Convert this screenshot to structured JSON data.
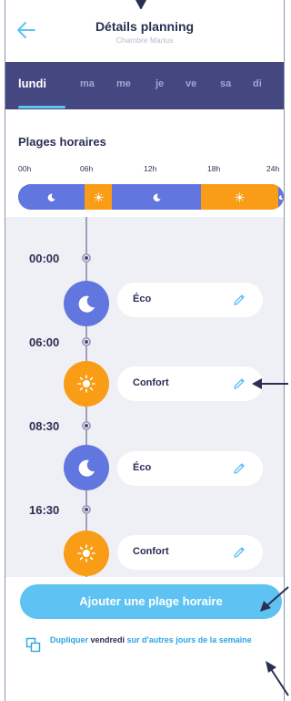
{
  "header": {
    "title": "Détails planning",
    "subtitle": "Chambre Marius"
  },
  "days": [
    {
      "label": "lundi",
      "active": true
    },
    {
      "label": "ma",
      "active": false
    },
    {
      "label": "me",
      "active": false
    },
    {
      "label": "je",
      "active": false
    },
    {
      "label": "ve",
      "active": false
    },
    {
      "label": "sa",
      "active": false
    },
    {
      "label": "di",
      "active": false
    }
  ],
  "ranges": {
    "title": "Plages horaires",
    "ticks": [
      "00h",
      "06h",
      "12h",
      "18h",
      "24h"
    ],
    "segments": [
      {
        "mode": "eco",
        "icon": "moon-icon",
        "start": "00:00",
        "end": "06:00"
      },
      {
        "mode": "confort",
        "icon": "sun-icon",
        "start": "06:00",
        "end": "08:30"
      },
      {
        "mode": "eco",
        "icon": "moon-icon",
        "start": "08:30",
        "end": "16:30"
      },
      {
        "mode": "confort",
        "icon": "sun-icon",
        "start": "16:30",
        "end": "23:30"
      },
      {
        "mode": "eco",
        "icon": "moon-icon",
        "start": "23:30",
        "end": "24:00"
      }
    ]
  },
  "timeline": [
    {
      "time": "00:00",
      "mode": "eco",
      "label": "Éco",
      "icon": "moon-icon"
    },
    {
      "time": "06:00",
      "mode": "confort",
      "label": "Confort",
      "icon": "sun-icon"
    },
    {
      "time": "08:30",
      "mode": "eco",
      "label": "Éco",
      "icon": "moon-icon"
    },
    {
      "time": "16:30",
      "mode": "confort",
      "label": "Confort",
      "icon": "sun-icon"
    }
  ],
  "actions": {
    "add_label": "Ajouter une plage horaire",
    "dup_prefix": "Dupliquer",
    "dup_day": "vendredi",
    "dup_suffix": "sur d'autres jours de la semaine"
  },
  "colors": {
    "eco": "#6176de",
    "confort": "#f99d17",
    "accent": "#5ec3f2",
    "days_bar": "#454781",
    "text": "#2b2f55"
  }
}
